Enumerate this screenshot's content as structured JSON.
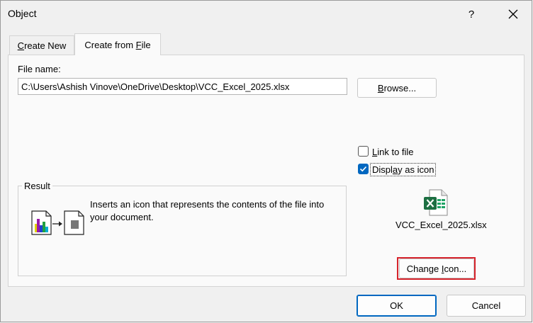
{
  "window": {
    "title": "Object",
    "help": "?"
  },
  "tabs": [
    {
      "prefix": "",
      "mn": "C",
      "suffix": "reate New"
    },
    {
      "prefix": "Create from ",
      "mn": "F",
      "suffix": "ile"
    }
  ],
  "file": {
    "label": "File name:",
    "value": "C:\\Users\\Ashish Vinove\\OneDrive\\Desktop\\VCC_Excel_2025.xlsx"
  },
  "browse": {
    "mn": "B",
    "suffix": "rowse..."
  },
  "link": {
    "prefix": "",
    "mn": "L",
    "suffix": "ink to file",
    "checked": false
  },
  "display": {
    "prefix": "Displ",
    "mn": "a",
    "suffix": "y as icon",
    "checked": true
  },
  "icon_preview": {
    "icon": "excel-file-icon",
    "caption": "VCC_Excel_2025.xlsx",
    "accent": "#1d6f42"
  },
  "change_icon": {
    "prefix": "Change ",
    "mn": "I",
    "suffix": "con..."
  },
  "result": {
    "title": "Result",
    "text": "Inserts an icon that represents the contents of the file into your document."
  },
  "buttons": {
    "ok": "OK",
    "cancel": "Cancel"
  },
  "colors": {
    "highlight": "#d6232b",
    "primary": "#0067c0"
  }
}
